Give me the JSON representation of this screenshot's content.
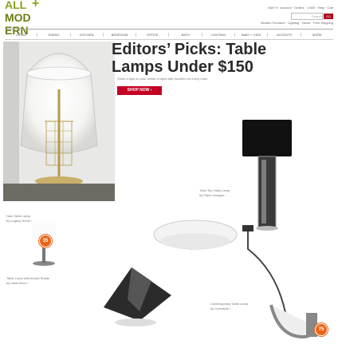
{
  "header": {
    "logo_line1": "ALL",
    "logo_plus": "+",
    "logo_line2": "MOD ERN",
    "top_links": "MAY 9 · Account · Orders · 1 800 · Help · Cart",
    "search_hint": "Search",
    "search_button": "GO",
    "tagline": "Modern Furniture · Lighting · Decor · Free Shipping"
  },
  "nav": [
    "Living",
    "Dining",
    "Kitchen",
    "Bedroom",
    "Office",
    "Bath",
    "Lighting",
    "Baby + Kids",
    "Accents",
    "More"
  ],
  "hero": {
    "headline": "Editors’ Picks: Table Lamps Under $150",
    "sub": "Shine a light on your sense of style with favorites for every room",
    "cta": "SHOP NOW ›"
  },
  "products": [
    {
      "name": "Tube Top Table Lamp",
      "brand": "by Pablo Designs ›"
    },
    {
      "name": "Halo Table Lamp",
      "brand": "by Legacy Home ›"
    },
    {
      "name": "Table Lamp with Acrylic Shade",
      "brand": "by Ideal Decor ›"
    },
    {
      "name": "Contemporary Table Lamp",
      "brand": "by Overstock ›"
    }
  ],
  "badges": {
    "halo": "35",
    "contemporary": "75"
  },
  "colors": {
    "accent": "#c40024",
    "badge": "#e8661a",
    "logo": "#8aa21a"
  }
}
